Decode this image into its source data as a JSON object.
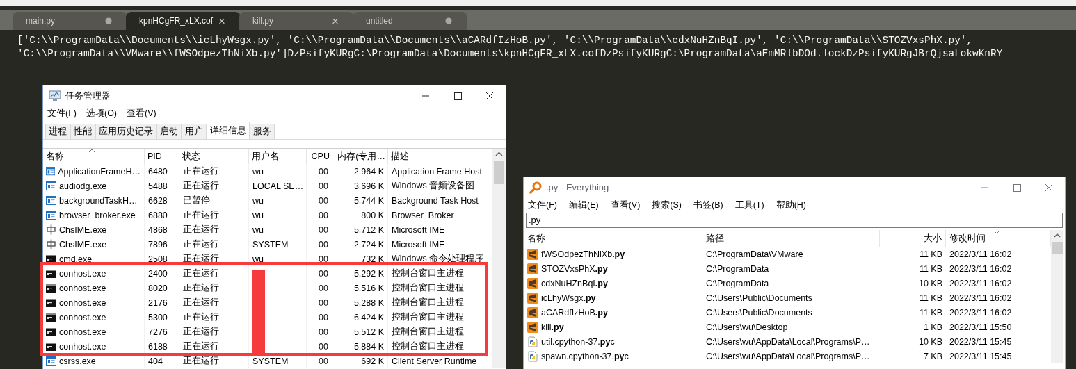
{
  "editor": {
    "tabs": [
      {
        "label": "main.py",
        "selected": false,
        "modified": true
      },
      {
        "label": "kpnHCgFR_xLX.cof",
        "selected": true,
        "close": "×"
      },
      {
        "label": "kill.py",
        "selected": false,
        "close": "×"
      },
      {
        "label": "untitled",
        "selected": false,
        "modified": true
      }
    ],
    "lines": [
      "['C:\\\\ProgramData\\\\Documents\\\\icLhyWsgx.py', 'C:\\\\ProgramData\\\\Documents\\\\aCARdfIzHoB.py', 'C:\\\\ProgramData\\\\cdxNuHZnBqI.py', 'C:\\\\ProgramData\\\\STOZVxsPhX.py',",
      "'C:\\\\ProgramData\\\\VMware\\\\fWSOdpezThNiXb.py']DzPsifyKURgC:\\ProgramData\\Documents\\kpnHCgFR_xLX.cofDzPsifyKURgC:\\ProgramData\\aEmMRlbDOd.lockDzPsifyKURgJBrQjsaLokwKnRY"
    ]
  },
  "task_manager": {
    "title": "任务管理器",
    "menu": [
      "文件(F)",
      "选项(O)",
      "查看(V)"
    ],
    "tabs": [
      {
        "label": "进程",
        "selected": false
      },
      {
        "label": "性能",
        "selected": false
      },
      {
        "label": "应用历史记录",
        "selected": false
      },
      {
        "label": "启动",
        "selected": false
      },
      {
        "label": "用户",
        "selected": false
      },
      {
        "label": "详细信息",
        "selected": true
      },
      {
        "label": "服务",
        "selected": false
      }
    ],
    "columns": [
      {
        "label": "名称",
        "kind": "sort_up"
      },
      {
        "label": "PID"
      },
      {
        "label": "状态"
      },
      {
        "label": "用户名"
      },
      {
        "label": "CPU"
      },
      {
        "label": "内存(专用…"
      },
      {
        "label": "描述"
      }
    ],
    "rows": [
      {
        "kind": "app",
        "name": "ApplicationFrameH…",
        "pid": "6480",
        "status": "正在运行",
        "user": "wu",
        "cpu": "00",
        "memory": "2,964 K",
        "description": "Application Frame Host"
      },
      {
        "kind": "app",
        "name": "audiodg.exe",
        "pid": "5488",
        "status": "正在运行",
        "user": "LOCAL SE…",
        "cpu": "00",
        "memory": "3,696 K",
        "description": "Windows 音频设备图"
      },
      {
        "kind": "app",
        "name": "backgroundTaskH…",
        "pid": "6628",
        "status": "已暂停",
        "user": "wu",
        "cpu": "00",
        "memory": "5,744 K",
        "description": "Background Task Host"
      },
      {
        "kind": "app",
        "name": "browser_broker.exe",
        "pid": "6880",
        "status": "正在运行",
        "user": "wu",
        "cpu": "00",
        "memory": "800 K",
        "description": "Browser_Broker"
      },
      {
        "kind": "ime",
        "name": "ChsIME.exe",
        "pid": "4868",
        "status": "正在运行",
        "user": "wu",
        "cpu": "00",
        "memory": "5,712 K",
        "description": "Microsoft IME"
      },
      {
        "kind": "ime",
        "name": "ChsIME.exe",
        "pid": "7896",
        "status": "正在运行",
        "user": "SYSTEM",
        "cpu": "00",
        "memory": "2,724 K",
        "description": "Microsoft IME"
      },
      {
        "kind": "console",
        "name": "cmd.exe",
        "pid": "2508",
        "status": "正在运行",
        "user": "wu",
        "cpu": "00",
        "memory": "732 K",
        "description": "Windows 命令处理程序"
      },
      {
        "kind": "console",
        "name": "conhost.exe",
        "pid": "2400",
        "status": "正在运行",
        "cpu": "00",
        "memory": "5,292 K",
        "description": "控制台窗口主进程"
      },
      {
        "kind": "console",
        "name": "conhost.exe",
        "pid": "8020",
        "status": "正在运行",
        "cpu": "00",
        "memory": "5,516 K",
        "description": "控制台窗口主进程"
      },
      {
        "kind": "console",
        "name": "conhost.exe",
        "pid": "2176",
        "status": "正在运行",
        "cpu": "00",
        "memory": "5,288 K",
        "description": "控制台窗口主进程"
      },
      {
        "kind": "console",
        "name": "conhost.exe",
        "pid": "5300",
        "status": "正在运行",
        "cpu": "00",
        "memory": "6,424 K",
        "description": "控制台窗口主进程"
      },
      {
        "kind": "console",
        "name": "conhost.exe",
        "pid": "7276",
        "status": "正在运行",
        "cpu": "00",
        "memory": "5,512 K",
        "description": "控制台窗口主进程"
      },
      {
        "kind": "console",
        "name": "conhost.exe",
        "pid": "6188",
        "status": "正在运行",
        "cpu": "00",
        "memory": "5,884 K",
        "description": "控制台窗口主进程"
      },
      {
        "kind": "app",
        "name": "csrss.exe",
        "pid": "404",
        "status": "正在运行",
        "user": "SYSTEM",
        "cpu": "00",
        "memory": "692 K",
        "description": "Client Server Runtime"
      }
    ]
  },
  "everything": {
    "title": ".py - Everything",
    "menu": [
      "文件(F)",
      "编辑(E)",
      "查看(V)",
      "搜索(S)",
      "书签(B)",
      "工具(T)",
      "帮助(H)"
    ],
    "search": {
      "value": ".py"
    },
    "columns": [
      {
        "label": "名称"
      },
      {
        "label": "路径"
      },
      {
        "label": "大小"
      },
      {
        "label": "修改时间",
        "kind": "sort_down"
      }
    ],
    "rows": [
      {
        "kind": "sublime",
        "name": "fWSOdpezThNiXb**.py**",
        "path": "C:\\ProgramData\\VMware",
        "size": "11 KB",
        "modified": "2022/3/11 16:02"
      },
      {
        "kind": "sublime",
        "name": "STOZVxsPhX**.py**",
        "path": "C:\\ProgramData",
        "size": "11 KB",
        "modified": "2022/3/11 16:02"
      },
      {
        "kind": "sublime",
        "name": "cdxNuHZnBqI**.py**",
        "path": "C:\\ProgramData",
        "size": "10 KB",
        "modified": "2022/3/11 16:02"
      },
      {
        "kind": "sublime",
        "name": "icLhyWsgx**.py**",
        "path": "C:\\Users\\Public\\Documents",
        "size": "11 KB",
        "modified": "2022/3/11 16:02"
      },
      {
        "kind": "sublime",
        "name": "aCARdfIzHoB**.py**",
        "path": "C:\\Users\\Public\\Documents",
        "size": "11 KB",
        "modified": "2022/3/11 16:02"
      },
      {
        "kind": "sublime",
        "name": "kill**.py**",
        "path": "C:\\Users\\wu\\Desktop",
        "size": "1 KB",
        "modified": "2022/3/11 15:50"
      },
      {
        "kind": "python",
        "name": "util.cpython-37.**py**c",
        "path": "C:\\Users\\wu\\AppData\\Local\\Programs\\P…",
        "size": "10 KB",
        "modified": "2022/3/11 15:45"
      },
      {
        "kind": "python",
        "name": "spawn.cpython-37.**py**c",
        "path": "C:\\Users\\wu\\AppData\\Local\\Programs\\P…",
        "size": "7 KB",
        "modified": "2022/3/11 15:45"
      }
    ]
  }
}
